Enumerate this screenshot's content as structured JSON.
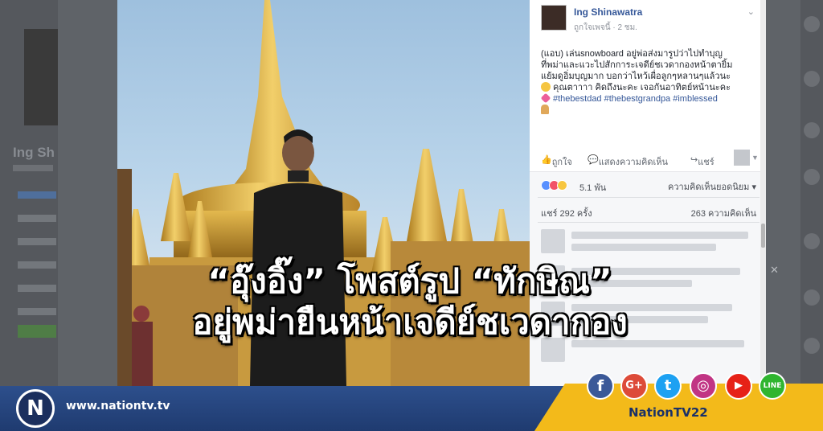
{
  "post": {
    "author": "Ing Shinawatra",
    "meta": "ถูกใจเพจนี้ · 2 ชม.",
    "text_lines": [
      "(แอบ) เล่นsnowboard อยู่พ่อส่งมารูปว่าไปทำบุญ",
      "ที่พม่าและแวะไปสักการะเจดีย์ชเวดากองหน้าตายิ้ม",
      "แย้มดูอิ่มบุญมาก บอกว่าไหว้เผื่อลูกๆหลานๆแล้วนะ",
      "คุณตาาาา คิดถึงนะคะ เจอกันอาทิตย์หน้านะคะ"
    ],
    "hashtags": "#thebestdad #thebestgrandpa #imblessed",
    "actions": {
      "like": "ถูกใจ",
      "comment": "แสดงความคิดเห็น",
      "share": "แชร์"
    },
    "reactions_count": "5.1 พัน",
    "top_comments_label": "ความคิดเห็นยอดนิยม",
    "shares": "แชร์ 292 ครั้ง",
    "comments": "263 ความคิดเห็น"
  },
  "background_page": {
    "name": "Ing Sh"
  },
  "headline": {
    "line1": "“อุ๊งอิ๊ง” โพสต์รูป “ทักษิณ”",
    "line2": "อยู่พม่ายืนหน้าเจดีย์ชเวดากอง"
  },
  "brand": {
    "logo_letter": "N",
    "url": "www.nationtv.tv",
    "handle": "NationTV22"
  },
  "social_icons": [
    {
      "name": "facebook-icon",
      "glyph": "f",
      "color": "#3b5998"
    },
    {
      "name": "google-plus-icon",
      "glyph": "G+",
      "color": "#dd4b39"
    },
    {
      "name": "twitter-icon",
      "glyph": "t",
      "color": "#1da1f2"
    },
    {
      "name": "instagram-icon",
      "glyph": "◎",
      "color": "#c13584"
    },
    {
      "name": "youtube-icon",
      "glyph": "▶",
      "color": "#e62117"
    },
    {
      "name": "line-icon",
      "glyph": "LINE",
      "color": "#2fb52f"
    }
  ],
  "colors": {
    "facebook_link": "#365899",
    "brand_blue": "#1f3b70",
    "brand_yellow": "#f3ba1a"
  }
}
